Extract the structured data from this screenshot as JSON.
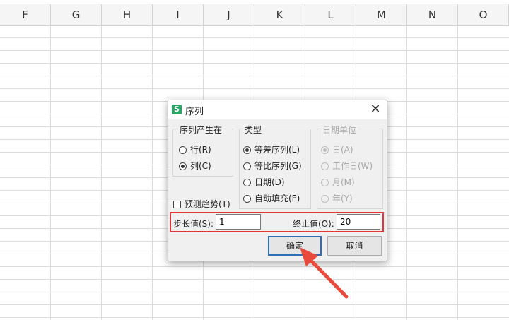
{
  "sheet": {
    "columns": [
      "F",
      "G",
      "H",
      "I",
      "J",
      "K",
      "L",
      "M",
      "N",
      "O"
    ]
  },
  "dialog": {
    "title": "序列",
    "app_icon": "S",
    "close_glyph": "✕",
    "series_in": {
      "label": "序列产生在",
      "options": [
        {
          "label": "行(R)",
          "selected": false
        },
        {
          "label": "列(C)",
          "selected": true
        }
      ]
    },
    "type": {
      "label": "类型",
      "options": [
        {
          "label": "等差序列(L)",
          "selected": true
        },
        {
          "label": "等比序列(G)",
          "selected": false
        },
        {
          "label": "日期(D)",
          "selected": false
        },
        {
          "label": "自动填充(F)",
          "selected": false
        }
      ]
    },
    "date_unit": {
      "label": "日期单位",
      "disabled": true,
      "options": [
        {
          "label": "日(A)",
          "selected": true
        },
        {
          "label": "工作日(W)",
          "selected": false
        },
        {
          "label": "月(M)",
          "selected": false
        },
        {
          "label": "年(Y)",
          "selected": false
        }
      ]
    },
    "trend": {
      "label": "预测趋势(T)",
      "checked": false
    },
    "step": {
      "label": "步长值(S):",
      "value": "1"
    },
    "stop": {
      "label": "终止值(O):",
      "value": "20"
    },
    "ok_label": "确定",
    "cancel_label": "取消"
  },
  "colors": {
    "highlight": "#e0373b",
    "arrow": "#e84a3c",
    "primary_border": "#2e6fb8",
    "app_icon": "#27a567"
  }
}
